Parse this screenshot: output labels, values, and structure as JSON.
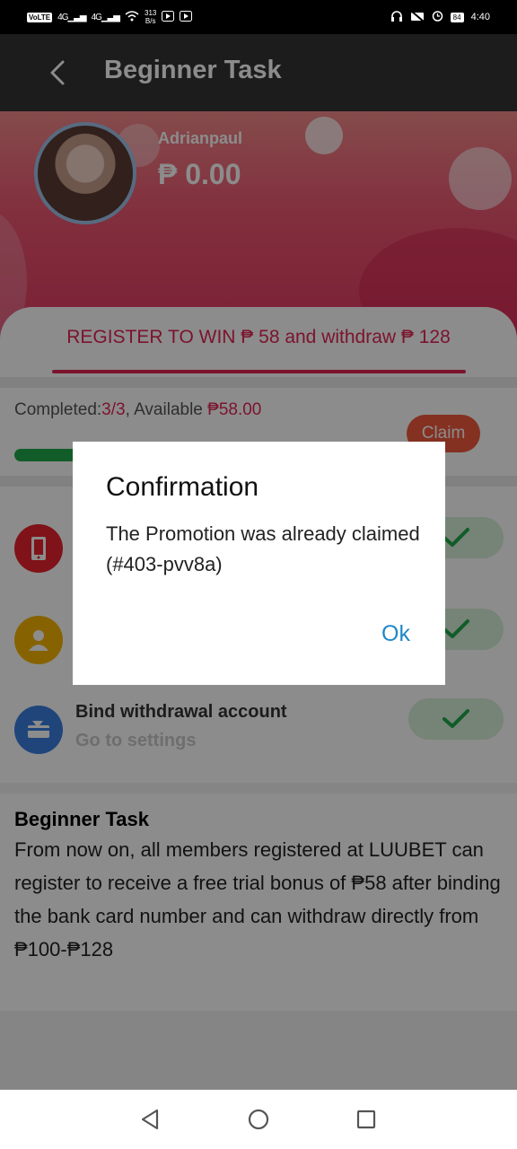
{
  "status_bar": {
    "left_chip": "VoLTE",
    "net1": "4G",
    "net2": "4G",
    "speed_value": "313",
    "speed_unit": "B/s",
    "battery": "84",
    "time": "4:40"
  },
  "header": {
    "title": "Beginner Task"
  },
  "profile": {
    "username": "Adrianpaul",
    "balance": "₱ 0.00"
  },
  "tab": {
    "label": "REGISTER TO WIN ₱ 58 and withdraw ₱ 128"
  },
  "progress": {
    "completed_label": "Completed:",
    "completed_value": "3/3",
    "available_label": ", Available ",
    "available_value": "₱58.00",
    "claim_label": "Claim",
    "fraction": 1.0
  },
  "tasks": [
    {
      "icon": "phone-icon",
      "title": "",
      "subtitle": "",
      "done": true
    },
    {
      "icon": "user-icon",
      "title": "",
      "subtitle": "",
      "done": true
    },
    {
      "icon": "card-icon",
      "title": "Bind withdrawal account",
      "subtitle": "Go to settings",
      "done": true
    }
  ],
  "description": {
    "title": "Beginner Task",
    "body": "From now on, all members registered at LUUBET can register to receive a free trial bonus of ₱58 after binding the bank card number and can withdraw directly from ₱100-₱128"
  },
  "dialog": {
    "title": "Confirmation",
    "message": "The Promotion was already claimed (#403-pvv8a)",
    "ok_label": "Ok"
  },
  "colors": {
    "accent": "#e12553",
    "claim": "#f15a3f",
    "success": "#1fa84a",
    "link": "#1e88c8"
  }
}
